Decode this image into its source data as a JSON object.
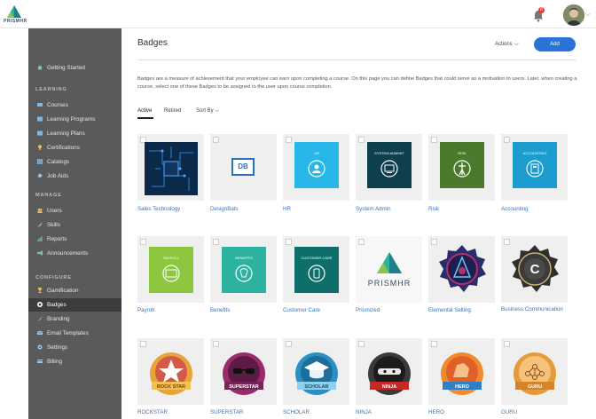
{
  "header": {
    "logo_text": "PRISMHR",
    "notification_count": "8"
  },
  "sidebar": {
    "top_items": [
      {
        "label": "Getting Started"
      }
    ],
    "sections": [
      {
        "title": "LEARNING",
        "items": [
          {
            "label": "Courses"
          },
          {
            "label": "Learning Programs"
          },
          {
            "label": "Learning Plans"
          },
          {
            "label": "Certifications"
          },
          {
            "label": "Catalogs"
          },
          {
            "label": "Job Aids"
          }
        ]
      },
      {
        "title": "MANAGE",
        "items": [
          {
            "label": "Users"
          },
          {
            "label": "Skills"
          },
          {
            "label": "Reports"
          },
          {
            "label": "Announcements"
          }
        ]
      },
      {
        "title": "CONFIGURE",
        "items": [
          {
            "label": "Gamification"
          },
          {
            "label": "Badges"
          },
          {
            "label": "Branding"
          },
          {
            "label": "Email Templates"
          },
          {
            "label": "Settings"
          },
          {
            "label": "Billing"
          }
        ]
      }
    ]
  },
  "main": {
    "title": "Badges",
    "actions_label": "Actions",
    "add_label": "Add",
    "description": "Badges are a measure of achievement that your employee can earn upon completing a course. On this page you can define Badges that could serve as a motivation to users. Later, when creating a course, select one of these Badges to be assigned to the user upon course completion.",
    "tabs": [
      {
        "label": "Active"
      },
      {
        "label": "Retired"
      },
      {
        "label": "Sort By"
      }
    ],
    "badges": [
      {
        "name": "Sales Technology"
      },
      {
        "name": "DesignBals",
        "tile_text": "DB"
      },
      {
        "name": "HR",
        "tile_text": "HR"
      },
      {
        "name": "System Admin",
        "tile_text": "SYSTEM ADMINIT"
      },
      {
        "name": "Risk",
        "tile_text": "RISK"
      },
      {
        "name": "Accounting",
        "tile_text": "ACCOUNTING"
      },
      {
        "name": "Payroll",
        "tile_text": "PAYROLL"
      },
      {
        "name": "Benefits",
        "tile_text": "BENEFITS"
      },
      {
        "name": "Customer Care",
        "tile_text": "CUSTOMER CARE"
      },
      {
        "name": "Prismized",
        "tile_text": "PRISMHR"
      },
      {
        "name": "Elemental Selling"
      },
      {
        "name": "Business Communication",
        "tile_text": "C"
      },
      {
        "name": "ROCKSTAR",
        "tile_text": "ROCK STAR"
      },
      {
        "name": "SUPERSTAR",
        "tile_text": "SUPERSTAR"
      },
      {
        "name": "SCHOLAR",
        "tile_text": "SCHOLAR"
      },
      {
        "name": "NINJA",
        "tile_text": "NINJA"
      },
      {
        "name": "HERO",
        "tile_text": "HERO"
      },
      {
        "name": "GURU",
        "tile_text": "GURU"
      }
    ]
  },
  "colors": {
    "sidebar_bg": "#5a5a5a",
    "sidebar_active": "#3d3d3d",
    "accent_blue": "#2a73d9",
    "link_blue": "#3a73b8"
  }
}
